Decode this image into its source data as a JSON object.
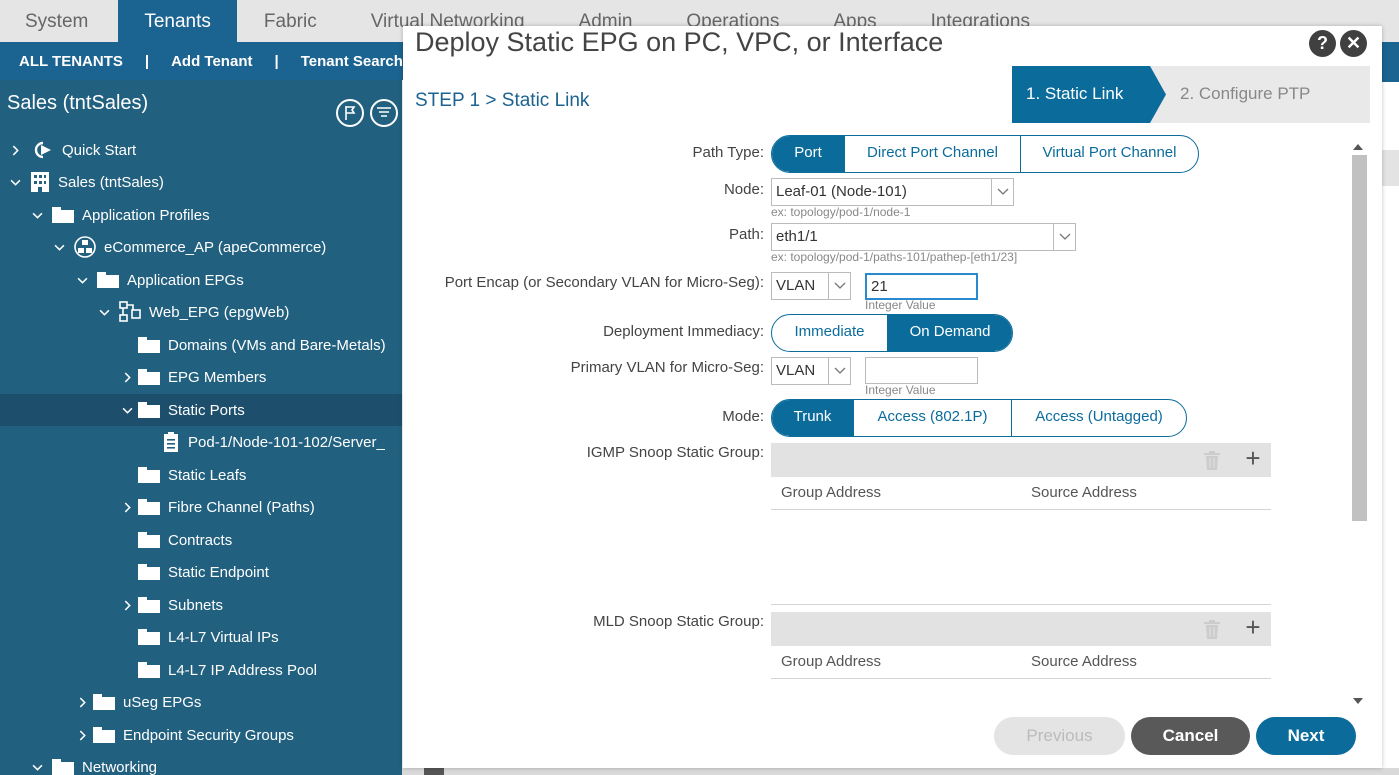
{
  "top_nav": {
    "tabs": [
      {
        "label": "System"
      },
      {
        "label": "Tenants",
        "active": true
      },
      {
        "label": "Fabric"
      },
      {
        "label": "Virtual Networking"
      },
      {
        "label": "Admin"
      },
      {
        "label": "Operations"
      },
      {
        "label": "Apps"
      },
      {
        "label": "Integrations"
      }
    ]
  },
  "sub_nav": {
    "all_tenants": "ALL TENANTS",
    "separator": "|",
    "add_tenant": "Add Tenant",
    "tenant_search": "Tenant Search:"
  },
  "sidebar": {
    "title": "Sales (tntSales)",
    "items": [
      {
        "label": "Quick Start"
      },
      {
        "label": "Sales (tntSales)"
      },
      {
        "label": "Application Profiles"
      },
      {
        "label": "eCommerce_AP (apeCommerce)"
      },
      {
        "label": "Application EPGs"
      },
      {
        "label": "Web_EPG (epgWeb)"
      },
      {
        "label": "Domains (VMs and Bare-Metals)"
      },
      {
        "label": "EPG Members"
      },
      {
        "label": "Static Ports"
      },
      {
        "label": "Pod-1/Node-101-102/Server_"
      },
      {
        "label": "Static Leafs"
      },
      {
        "label": "Fibre Channel (Paths)"
      },
      {
        "label": "Contracts"
      },
      {
        "label": "Static Endpoint"
      },
      {
        "label": "Subnets"
      },
      {
        "label": "L4-L7 Virtual IPs"
      },
      {
        "label": "L4-L7 IP Address Pool"
      },
      {
        "label": "uSeg EPGs"
      },
      {
        "label": "Endpoint Security Groups"
      },
      {
        "label": "Networking"
      }
    ]
  },
  "modal": {
    "title": "Deploy Static EPG on PC, VPC, or Interface",
    "help": "?",
    "close": "✕",
    "step_title": "STEP 1 > Static Link",
    "wizard_steps": [
      "1. Static Link",
      "2. Configure PTP"
    ],
    "form": {
      "path_type": {
        "label": "Path Type:",
        "options": [
          "Port",
          "Direct Port Channel",
          "Virtual Port Channel"
        ],
        "selected": "Port"
      },
      "node": {
        "label": "Node:",
        "value": "Leaf-01 (Node-101)",
        "hint": "ex: topology/pod-1/node-1"
      },
      "path": {
        "label": "Path:",
        "value": "eth1/1",
        "hint": "ex: topology/pod-1/paths-101/pathep-[eth1/23]"
      },
      "port_encap": {
        "label": "Port Encap (or Secondary VLAN for Micro-Seg):",
        "type": "VLAN",
        "value": "21",
        "hint": "Integer Value"
      },
      "deployment": {
        "label": "Deployment Immediacy:",
        "options": [
          "Immediate",
          "On Demand"
        ],
        "selected": "On Demand"
      },
      "primary_vlan": {
        "label": "Primary VLAN for Micro-Seg:",
        "type": "VLAN",
        "value": "",
        "hint": "Integer Value"
      },
      "mode": {
        "label": "Mode:",
        "options": [
          "Trunk",
          "Access (802.1P)",
          "Access (Untagged)"
        ],
        "selected": "Trunk"
      },
      "igmp": {
        "label": "IGMP Snoop Static Group:",
        "columns": [
          "Group Address",
          "Source Address"
        ]
      },
      "mld": {
        "label": "MLD Snoop Static Group:",
        "columns": [
          "Group Address",
          "Source Address"
        ]
      }
    },
    "buttons": {
      "previous": "Previous",
      "cancel": "Cancel",
      "next": "Next"
    }
  }
}
